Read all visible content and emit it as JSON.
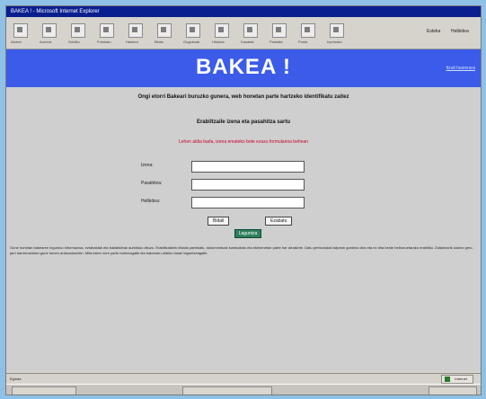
{
  "window": {
    "title": "BAKEA ! - Microsoft Internet Explorer"
  },
  "toolbar": {
    "buttons": [
      {
        "name": "back-icon",
        "label": "Atzera"
      },
      {
        "name": "forward-icon",
        "label": "Aurrera"
      },
      {
        "name": "stop-icon",
        "label": "Gelditu"
      },
      {
        "name": "refresh-icon",
        "label": "Freskatu"
      },
      {
        "name": "home-icon",
        "label": "Hasiera"
      },
      {
        "name": "search-icon",
        "label": "Bilatu"
      },
      {
        "name": "favorites-icon",
        "label": "Gogokoak"
      },
      {
        "name": "history-icon",
        "label": "Historia"
      },
      {
        "name": "channels-icon",
        "label": "Kanalak"
      },
      {
        "name": "fullscreen-icon",
        "label": "Pantaila"
      },
      {
        "name": "mail-icon",
        "label": "Posta"
      },
      {
        "name": "print-icon",
        "label": "Inprimatu"
      }
    ],
    "right_links": [
      "Esteka",
      "Helbidea"
    ]
  },
  "banner": {
    "title": "BAKEA !",
    "link": "Itzuli hasierara"
  },
  "content": {
    "welcome": "Ongi etorri Bakeari buruzko gunera, web honetan parte hartzeko identifikatu zaitez",
    "subtitle": "Erabiltzaile izena eta pasahitza sartu",
    "notice": "Lehen aldia bada, izena emateko bete ezazu formularioa behean",
    "fields": [
      {
        "label": "Izena:",
        "value": ""
      },
      {
        "label": "Pasahitza:",
        "value": ""
      },
      {
        "label": "Helbidea:",
        "value": ""
      }
    ],
    "buttons": {
      "submit": "Bidali",
      "reset": "Ezabatu"
    },
    "help_badge": "Laguntza",
    "paragraph": "Gune honetan bakearen inguruko informazioa, eztabaidak eta baliabideak aurkituko dituzu. Erabiltzaileek iritziak partekatu, dokumentuak kontsultatu eta ekimenetan parte har dezakete. Datu pertsonalak isilpean gordeko dira eta ez dira beste helburuetarako erabiliko. Zalantzarik izanez gero, jarri harremanetan gune honen arduradunekin. Mila esker zure parte hartzeagatik eta bakearen aldeko lanari laguntzeagatik."
  },
  "statusbar": {
    "text": "Eginda",
    "zone": "Internet"
  }
}
